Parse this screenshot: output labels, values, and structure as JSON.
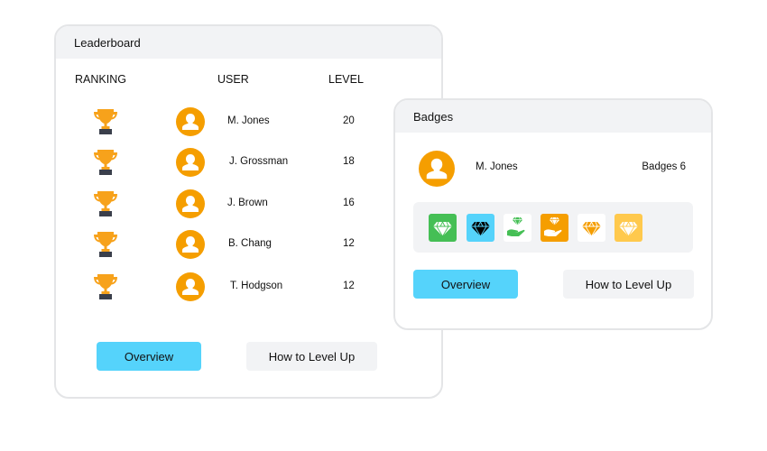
{
  "leaderboard": {
    "title": "Leaderboard",
    "columns": {
      "ranking": "RANKING",
      "user": "USER",
      "level": "LEVEL"
    },
    "rows": [
      {
        "name": "M. Jones",
        "level": "20"
      },
      {
        "name": "J. Grossman",
        "level": "18"
      },
      {
        "name": "J. Brown",
        "level": "16"
      },
      {
        "name": "B. Chang",
        "level": "12"
      },
      {
        "name": "T. Hodgson",
        "level": "12"
      }
    ],
    "overview_label": "Overview",
    "level_up_label": "How to Level Up"
  },
  "badges": {
    "title": "Badges",
    "user_name": "M. Jones",
    "count_label": "Badges 6",
    "items": [
      {
        "icon": "diamond-icon",
        "bg": "#45bf55",
        "fg": "#ffffff"
      },
      {
        "icon": "diamond-icon",
        "bg": "#55d3fb",
        "fg": "#000000"
      },
      {
        "icon": "diamond-hand-icon",
        "bg": "#ffffff",
        "fg": "#45bf55"
      },
      {
        "icon": "diamond-hand-icon",
        "bg": "#f59e00",
        "fg": "#ffffff"
      },
      {
        "icon": "diamond-icon",
        "bg": "#ffffff",
        "fg": "#f59e00"
      },
      {
        "icon": "diamond-icon",
        "bg": "#ffc94d",
        "fg": "#ffffff"
      }
    ],
    "overview_label": "Overview",
    "level_up_label": "How to Level Up"
  },
  "colors": {
    "accent": "#55d3fb",
    "avatar": "#f59e00",
    "trophy": "#f7a21b",
    "trophy_base": "#3a3f4b",
    "header_bg": "#f2f3f5"
  }
}
